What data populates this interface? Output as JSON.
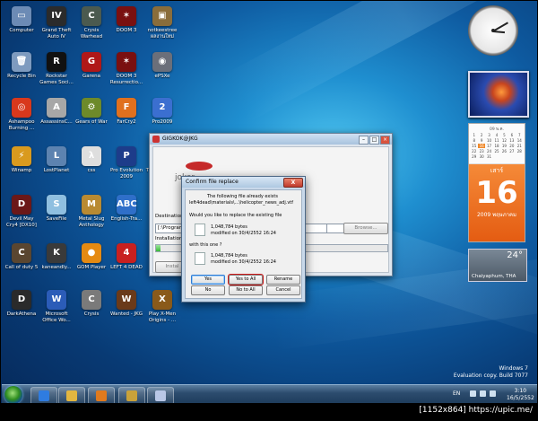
{
  "desktop": {
    "icons": [
      {
        "label": "Computer",
        "icon": "computer-icon",
        "color": "#6c8bb5",
        "glyph": "▭"
      },
      {
        "label": "Grand Theft Auto IV",
        "icon": "gta4-icon",
        "color": "#2b2b2b",
        "glyph": "IV"
      },
      {
        "label": "Crysis Warhead",
        "icon": "crysis-warhead-icon",
        "color": "#4b5a4f",
        "glyph": "C"
      },
      {
        "label": "DOOM 3",
        "icon": "doom3-icon",
        "color": "#7a1010",
        "glyph": "✶"
      },
      {
        "label": "notkeestree ผลงานใหม่",
        "icon": "folder-icon",
        "color": "#8a6d3b",
        "glyph": "▣"
      },
      {
        "label": "Recycle Bin",
        "icon": "recycle-bin-icon",
        "color": "#7e9bbf",
        "glyph": "🗑"
      },
      {
        "label": "Rockstar Games Soci...",
        "icon": "rockstar-icon",
        "color": "#111111",
        "glyph": "R"
      },
      {
        "label": "Garena",
        "icon": "garena-icon",
        "color": "#b01818",
        "glyph": "G"
      },
      {
        "label": "DOOM 3 Resurrectio...",
        "icon": "doom3-roe-icon",
        "color": "#7a1010",
        "glyph": "✶"
      },
      {
        "label": "ePSXe",
        "icon": "gamepad-icon",
        "color": "#6b6f7a",
        "glyph": "◉"
      },
      {
        "label": "Ashampoo Burning ...",
        "icon": "ashampoo-icon",
        "color": "#d8381c",
        "glyph": "◎"
      },
      {
        "label": "AssassinsC...",
        "icon": "assassins-creed-icon",
        "color": "#a7a7a7",
        "glyph": "A"
      },
      {
        "label": "Gears of War",
        "icon": "gears-of-war-icon",
        "color": "#6d8a2a",
        "glyph": "⚙"
      },
      {
        "label": "FarCry2",
        "icon": "farcry2-icon",
        "color": "#e0701e",
        "glyph": "F"
      },
      {
        "label": "Pro2009",
        "icon": "pro2009-icon",
        "color": "#3b6fd0",
        "glyph": "2"
      },
      {
        "label": "Winamp",
        "icon": "winamp-icon",
        "color": "#d99a1e",
        "glyph": "⚡"
      },
      {
        "label": "LostPlanet",
        "icon": "lost-planet-icon",
        "color": "#5d83b0",
        "glyph": "L"
      },
      {
        "label": "css",
        "icon": "half-life-icon",
        "color": "#dedede",
        "glyph": "λ"
      },
      {
        "label": "Pro Evolution 2009",
        "icon": "pes-icon",
        "color": "#1d3c8a",
        "glyph": "P"
      },
      {
        "label": "ThaiTransla...",
        "icon": "thai-translate-icon",
        "color": "#2a62c9",
        "glyph": "ก"
      },
      {
        "label": "Devil May Cry4 [DX10]",
        "icon": "devil-may-cry-icon",
        "color": "#6b1818",
        "glyph": "D"
      },
      {
        "label": "SaveFile",
        "icon": "savefile-icon",
        "color": "#8fbfe0",
        "glyph": "S"
      },
      {
        "label": "Metal Slug Anthology",
        "icon": "metal-slug-icon",
        "color": "#b98a32",
        "glyph": "M"
      },
      {
        "label": "English-Tra...",
        "icon": "english-translate-icon",
        "color": "#2f6fc9",
        "glyph": "ABC"
      },
      {
        "label": "GRID",
        "icon": "grid-icon",
        "color": "#2a2a2a",
        "glyph": "▦"
      },
      {
        "label": "Call of duty 5",
        "icon": "call-of-duty-icon",
        "color": "#5a4630",
        "glyph": "C"
      },
      {
        "label": "kaneandly...",
        "icon": "kane-lynch-icon",
        "color": "#3a3a3a",
        "glyph": "K"
      },
      {
        "label": "GOM Player",
        "icon": "gom-player-icon",
        "color": "#e58a12",
        "glyph": "●"
      },
      {
        "label": "LEFT 4 DEAD",
        "icon": "left4dead-icon",
        "color": "#c82020",
        "glyph": "4"
      },
      {
        "label": "Wanted",
        "icon": "wanted-icon",
        "color": "#7a4a20",
        "glyph": "W"
      },
      {
        "label": "DarkAthena",
        "icon": "dark-athena-icon",
        "color": "#2a2a2a",
        "glyph": "D"
      },
      {
        "label": "Microsoft Office Wo...",
        "icon": "word-icon",
        "color": "#2b5cb8",
        "glyph": "W"
      },
      {
        "label": "Crysis",
        "icon": "crysis-icon",
        "color": "#7a7a7a",
        "glyph": "C"
      },
      {
        "label": "Wanted - JKG",
        "icon": "wanted-jkg-icon",
        "color": "#6a3a1a",
        "glyph": "W"
      },
      {
        "label": "Play X-Men Origins - ...",
        "icon": "xmen-icon",
        "color": "#8a5a1a",
        "glyph": "X"
      }
    ]
  },
  "gadgets": {
    "calendar": {
      "month_header": "09 พ.ค.",
      "days": [
        "1",
        "2",
        "3",
        "4",
        "5",
        "6",
        "7",
        "8",
        "9",
        "10",
        "11",
        "12",
        "13",
        "14",
        "15",
        "16",
        "17",
        "18",
        "19",
        "20",
        "21",
        "22",
        "23",
        "24",
        "25",
        "26",
        "27",
        "28",
        "29",
        "30",
        "31"
      ],
      "today": "16",
      "day_of_week": "เสาร์",
      "day": "16",
      "month_year": "2009 พฤษภาคม"
    },
    "weather": {
      "temp": "24°",
      "location": "Chaiyaphum, THA"
    }
  },
  "watermark": {
    "line1": "Windows 7",
    "line2": "Evaluation copy. Build 7077"
  },
  "taskbar": {
    "lang": "EN",
    "time": "3:10",
    "date": "16/5/2552",
    "items": [
      {
        "icon": "internet-explorer-icon",
        "color": "#2f7ce0"
      },
      {
        "icon": "windows-explorer-icon",
        "color": "#e2b640"
      },
      {
        "icon": "media-player-icon",
        "color": "#e07a1e"
      },
      {
        "icon": "installer-icon",
        "color": "#c9a23a"
      },
      {
        "icon": "app-window-icon",
        "color": "#b9c7e6"
      }
    ]
  },
  "installer": {
    "title": "GIGKOK@JKG",
    "banner_text": "joker",
    "destination_label": "Destination f",
    "path": "[:\\Program",
    "drive": "0 @",
    "browse": "Browse...",
    "installation_label": "Installation pr",
    "progress": 0.02,
    "install_button": "Instal"
  },
  "confirm": {
    "title": "Confirm file replace",
    "message1": "The following file already exists",
    "path": "left4dead\\materials\\...\\helicopter_news_adj.vtf",
    "question": "Would you like to replace the existing file",
    "existing_size": "1,048,784 bytes",
    "existing_modified": "modified on 30/4/2552 16:24",
    "with_label": "with this one ?",
    "new_size": "1,048,784 bytes",
    "new_modified": "modified on 30/4/2552 16:24",
    "buttons": {
      "yes": "Yes",
      "yes_to_all": "Yes to All",
      "rename": "Rename",
      "no": "No",
      "no_to_all": "No to All",
      "cancel": "Cancel"
    },
    "close": "X"
  },
  "credit": "[1152x864] https://upic.me/"
}
